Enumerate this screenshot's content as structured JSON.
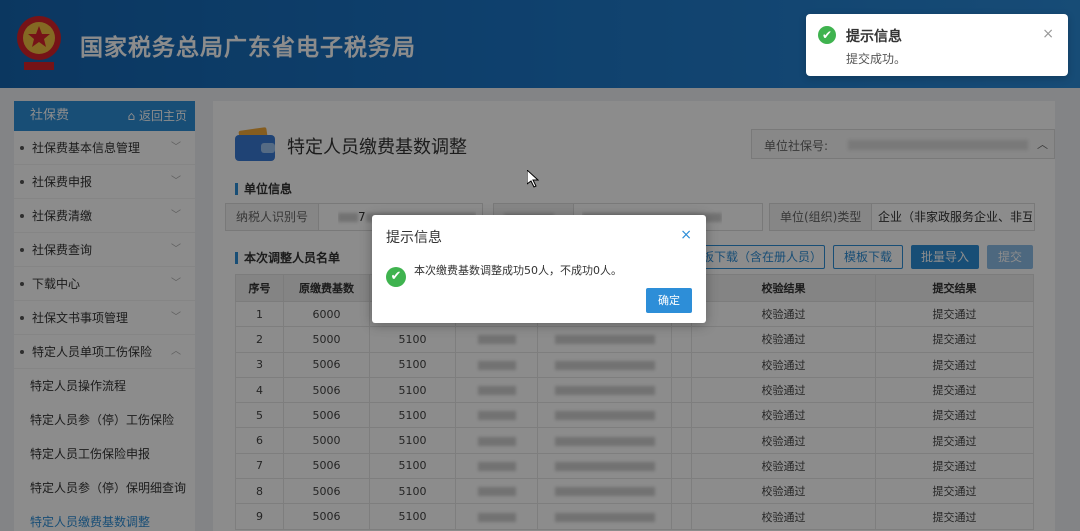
{
  "header": {
    "site_title": "国家税务总局广东省电子税务局"
  },
  "toast": {
    "title": "提示信息",
    "message": "提交成功。",
    "close": "×"
  },
  "sidebar": {
    "title": "社保费",
    "home": "返回主页",
    "items": [
      {
        "label": "社保费基本信息管理"
      },
      {
        "label": "社保费申报"
      },
      {
        "label": "社保费清缴"
      },
      {
        "label": "社保费查询"
      },
      {
        "label": "下载中心"
      },
      {
        "label": "社保文书事项管理"
      },
      {
        "label": "特定人员单项工伤保险"
      }
    ],
    "subitems": [
      {
        "label": "特定人员操作流程"
      },
      {
        "label": "特定人员参（停）工伤保险"
      },
      {
        "label": "特定人员工伤保险申报"
      },
      {
        "label": "特定人员参（停）保明细查询"
      },
      {
        "label": "特定人员缴费基数调整"
      }
    ]
  },
  "page": {
    "title": "特定人员缴费基数调整",
    "ssn_label": "单位社保号:",
    "section_unit": "单位信息",
    "field_taxid": "纳税人识别号",
    "field_taxid_value_prefix": "7",
    "field_org_type": "单位(组织)类型",
    "field_org_type_value": "企业（非家政服务企业、非互联网",
    "section_list": "本次调整人员名单",
    "btn_download_tpl_reg": "板下载（含在册人员）",
    "btn_download_tpl": "模板下载",
    "btn_import": "批量导入",
    "btn_submit": "提交"
  },
  "table": {
    "headers": [
      "序号",
      "原缴费基数",
      "",
      "",
      "",
      "",
      "校验结果",
      "提交结果"
    ],
    "rows": [
      {
        "no": "1",
        "old": "6000",
        "new": "",
        "check": "校验通过",
        "submit": "提交通过"
      },
      {
        "no": "2",
        "old": "5000",
        "new": "5100",
        "check": "校验通过",
        "submit": "提交通过"
      },
      {
        "no": "3",
        "old": "5006",
        "new": "5100",
        "check": "校验通过",
        "submit": "提交通过"
      },
      {
        "no": "4",
        "old": "5006",
        "new": "5100",
        "check": "校验通过",
        "submit": "提交通过"
      },
      {
        "no": "5",
        "old": "5006",
        "new": "5100",
        "check": "校验通过",
        "submit": "提交通过"
      },
      {
        "no": "6",
        "old": "5000",
        "new": "5100",
        "check": "校验通过",
        "submit": "提交通过"
      },
      {
        "no": "7",
        "old": "5006",
        "new": "5100",
        "check": "校验通过",
        "submit": "提交通过"
      },
      {
        "no": "8",
        "old": "5006",
        "new": "5100",
        "check": "校验通过",
        "submit": "提交通过"
      },
      {
        "no": "9",
        "old": "5006",
        "new": "5100",
        "check": "校验通过",
        "submit": "提交通过"
      }
    ]
  },
  "dialog": {
    "title": "提示信息",
    "close": "×",
    "message": "本次缴费基数调整成功50人，不成功0人。",
    "ok": "确定"
  },
  "colors": {
    "primary": "#2d8ed8",
    "success": "#3fb34f",
    "header": "#1a73c4"
  }
}
